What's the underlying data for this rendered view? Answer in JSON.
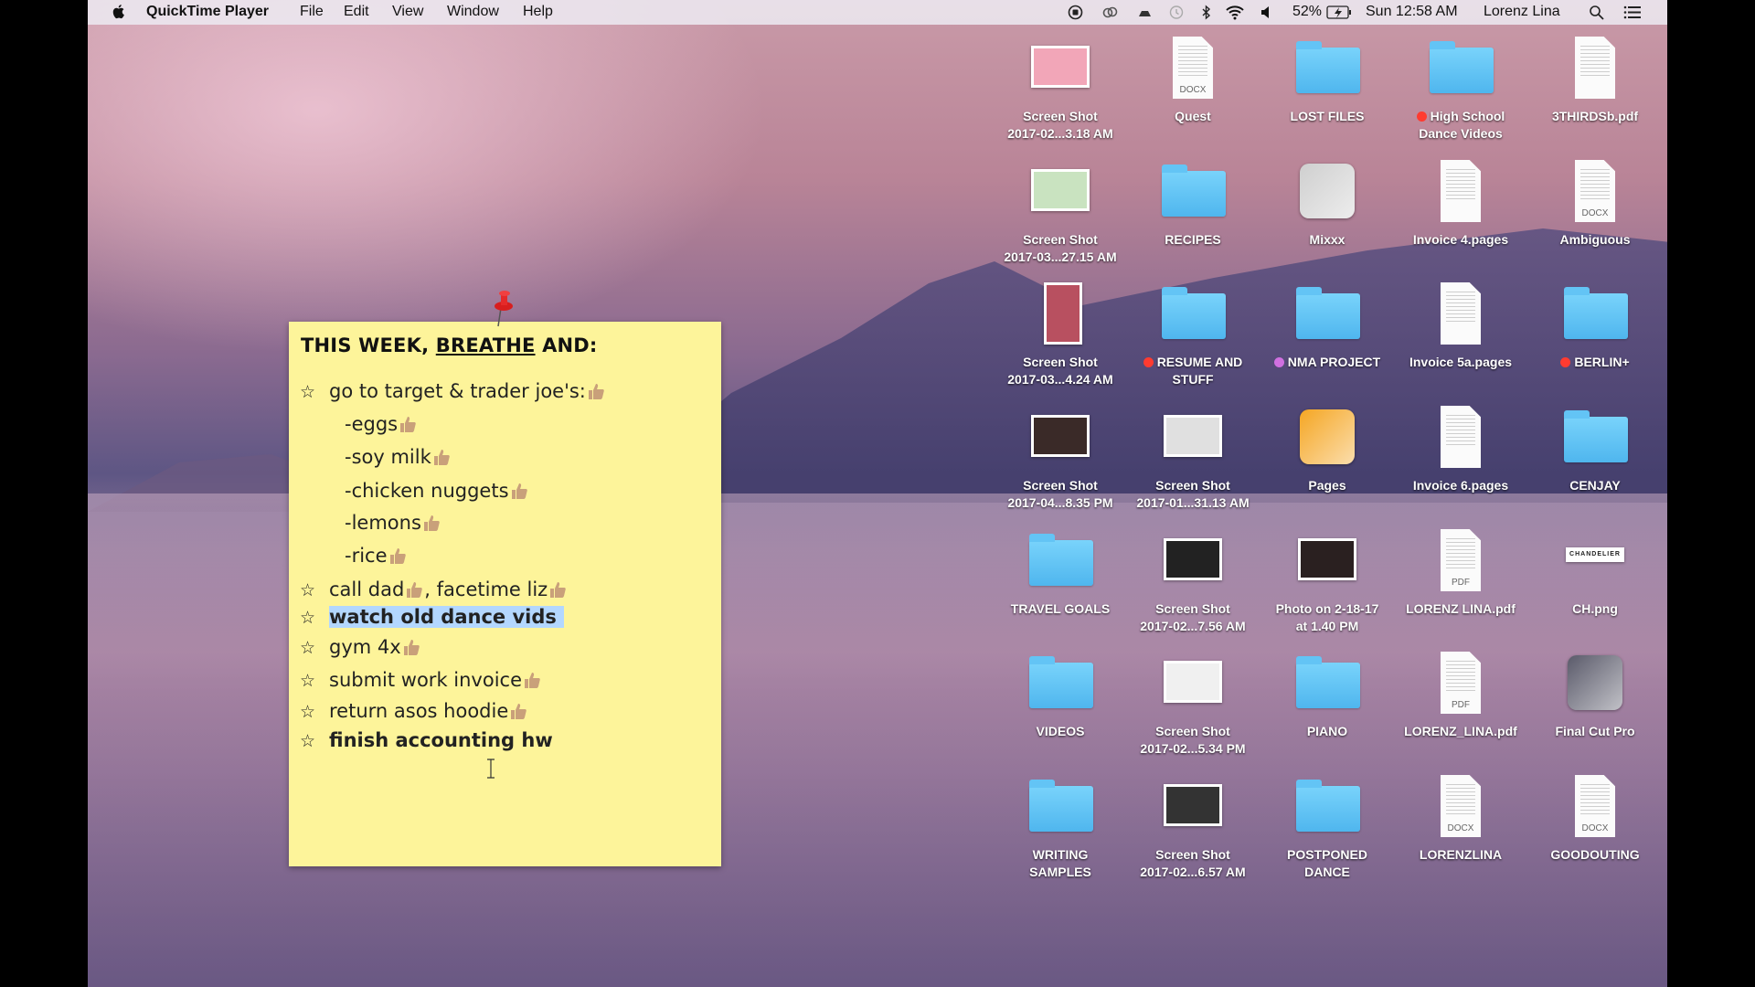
{
  "menubar": {
    "app_name": "QuickTime Player",
    "menus": [
      "File",
      "Edit",
      "View",
      "Window",
      "Help"
    ],
    "battery": "52%",
    "clock": "Sun 12:58 AM",
    "user": "Lorenz Lina",
    "status_icons": [
      "screen-record-icon",
      "creative-cloud-icon",
      "drive-icon",
      "time-machine-icon",
      "bluetooth-icon",
      "wifi-icon",
      "volume-icon",
      "battery-charging-icon"
    ]
  },
  "note": {
    "title_pre": "THIS WEEK, ",
    "title_underlined": "BREATHE",
    "title_post": " AND:",
    "lines": [
      {
        "text": "go to target & trader joe's: ",
        "star": true,
        "thumbs": 1
      },
      {
        "text": "-eggs",
        "star": false,
        "thumbs": 1
      },
      {
        "text": "-soy milk",
        "star": false,
        "thumbs": 1
      },
      {
        "text": "-chicken nuggets",
        "star": false,
        "thumbs": 1
      },
      {
        "text": "-lemons",
        "star": false,
        "thumbs": 1
      },
      {
        "text": "-rice",
        "star": false,
        "thumbs": 1
      },
      {
        "text": "call dad",
        "text2": ", facetime liz",
        "star": true,
        "thumbs": 2
      },
      {
        "text": "watch old dance vids",
        "star": true,
        "thumbs": 0,
        "bold": true,
        "selected": true
      },
      {
        "text": "gym 4x ",
        "star": true,
        "thumbs": 1
      },
      {
        "text": "submit work invoice",
        "star": true,
        "thumbs": 1
      },
      {
        "text": "return asos hoodie",
        "star": true,
        "thumbs": 1
      },
      {
        "text": "finish accounting hw",
        "star": true,
        "thumbs": 0,
        "bold": true
      }
    ]
  },
  "desktop_icons": [
    {
      "label": [
        "Screen Shot",
        "2017-02...3.18 AM"
      ],
      "type": "shot",
      "thumb": "#f2a6b8"
    },
    {
      "label": [
        "Quest"
      ],
      "type": "doc",
      "badge": "DOCX"
    },
    {
      "label": [
        "LOST FILES"
      ],
      "type": "folder"
    },
    {
      "label": [
        "High School",
        "Dance Videos"
      ],
      "type": "folder",
      "tag": "#ff3b30"
    },
    {
      "label": [
        "3THIRDSb.pdf"
      ],
      "type": "doc"
    },
    {
      "label": [
        "Screen Shot",
        "2017-03...27.15 AM"
      ],
      "type": "shot",
      "thumb": "#c9e3c0"
    },
    {
      "label": [
        "RECIPES"
      ],
      "type": "folder"
    },
    {
      "label": [
        "Mixxx"
      ],
      "type": "app",
      "color": "#cfcfcf"
    },
    {
      "label": [
        "Invoice 4.pages"
      ],
      "type": "doc"
    },
    {
      "label": [
        "Ambiguous"
      ],
      "type": "doc",
      "badge": "DOCX"
    },
    {
      "label": [
        "Screen Shot",
        "2017-03...4.24 AM"
      ],
      "type": "shot",
      "tall": true,
      "thumb": "#b85060"
    },
    {
      "label": [
        "RESUME AND",
        "STUFF"
      ],
      "type": "folder",
      "tag": "#ff3b30"
    },
    {
      "label": [
        "NMA PROJECT"
      ],
      "type": "folder",
      "tag": "#d070e0"
    },
    {
      "label": [
        "Invoice 5a.pages"
      ],
      "type": "doc"
    },
    {
      "label": [
        "BERLIN+"
      ],
      "type": "folder",
      "tag": "#ff3b30"
    },
    {
      "label": [
        "Screen Shot",
        "2017-04...8.35 PM"
      ],
      "type": "shot",
      "thumb": "#3a2a28"
    },
    {
      "label": [
        "Screen Shot",
        "2017-01...31.13 AM"
      ],
      "type": "shot",
      "thumb": "#e0e0e0"
    },
    {
      "label": [
        "Pages"
      ],
      "type": "app",
      "color": "#f5a623"
    },
    {
      "label": [
        "Invoice 6.pages"
      ],
      "type": "doc"
    },
    {
      "label": [
        "CENJAY"
      ],
      "type": "folder"
    },
    {
      "label": [
        "TRAVEL GOALS"
      ],
      "type": "folder"
    },
    {
      "label": [
        "Screen Shot",
        "2017-02...7.56 AM"
      ],
      "type": "shot",
      "thumb": "#222222"
    },
    {
      "label": [
        "Photo on 2-18-17",
        "at 1.40 PM"
      ],
      "type": "shot",
      "thumb": "#2a2020"
    },
    {
      "label": [
        "LORENZ LINA.pdf"
      ],
      "type": "doc",
      "badge": "PDF"
    },
    {
      "label": [
        "CH.png"
      ],
      "type": "png",
      "badge": "CHANDELIER"
    },
    {
      "label": [
        "VIDEOS"
      ],
      "type": "folder"
    },
    {
      "label": [
        "Screen Shot",
        "2017-02...5.34 PM"
      ],
      "type": "shot",
      "thumb": "#f0f0f0"
    },
    {
      "label": [
        "PIANO"
      ],
      "type": "folder"
    },
    {
      "label": [
        "LORENZ_LINA.pdf"
      ],
      "type": "doc",
      "badge": "PDF"
    },
    {
      "label": [
        "Final Cut Pro"
      ],
      "type": "app",
      "color": "#5a5a6a"
    },
    {
      "label": [
        "WRITING",
        "SAMPLES"
      ],
      "type": "folder"
    },
    {
      "label": [
        "Screen Shot",
        "2017-02...6.57 AM"
      ],
      "type": "shot",
      "thumb": "#333333"
    },
    {
      "label": [
        "POSTPONED",
        "DANCE"
      ],
      "type": "folder"
    },
    {
      "label": [
        "LORENZLINA"
      ],
      "type": "doc",
      "badge": "DOCX"
    },
    {
      "label": [
        "GOODOUTING"
      ],
      "type": "doc",
      "badge": "DOCX"
    }
  ]
}
